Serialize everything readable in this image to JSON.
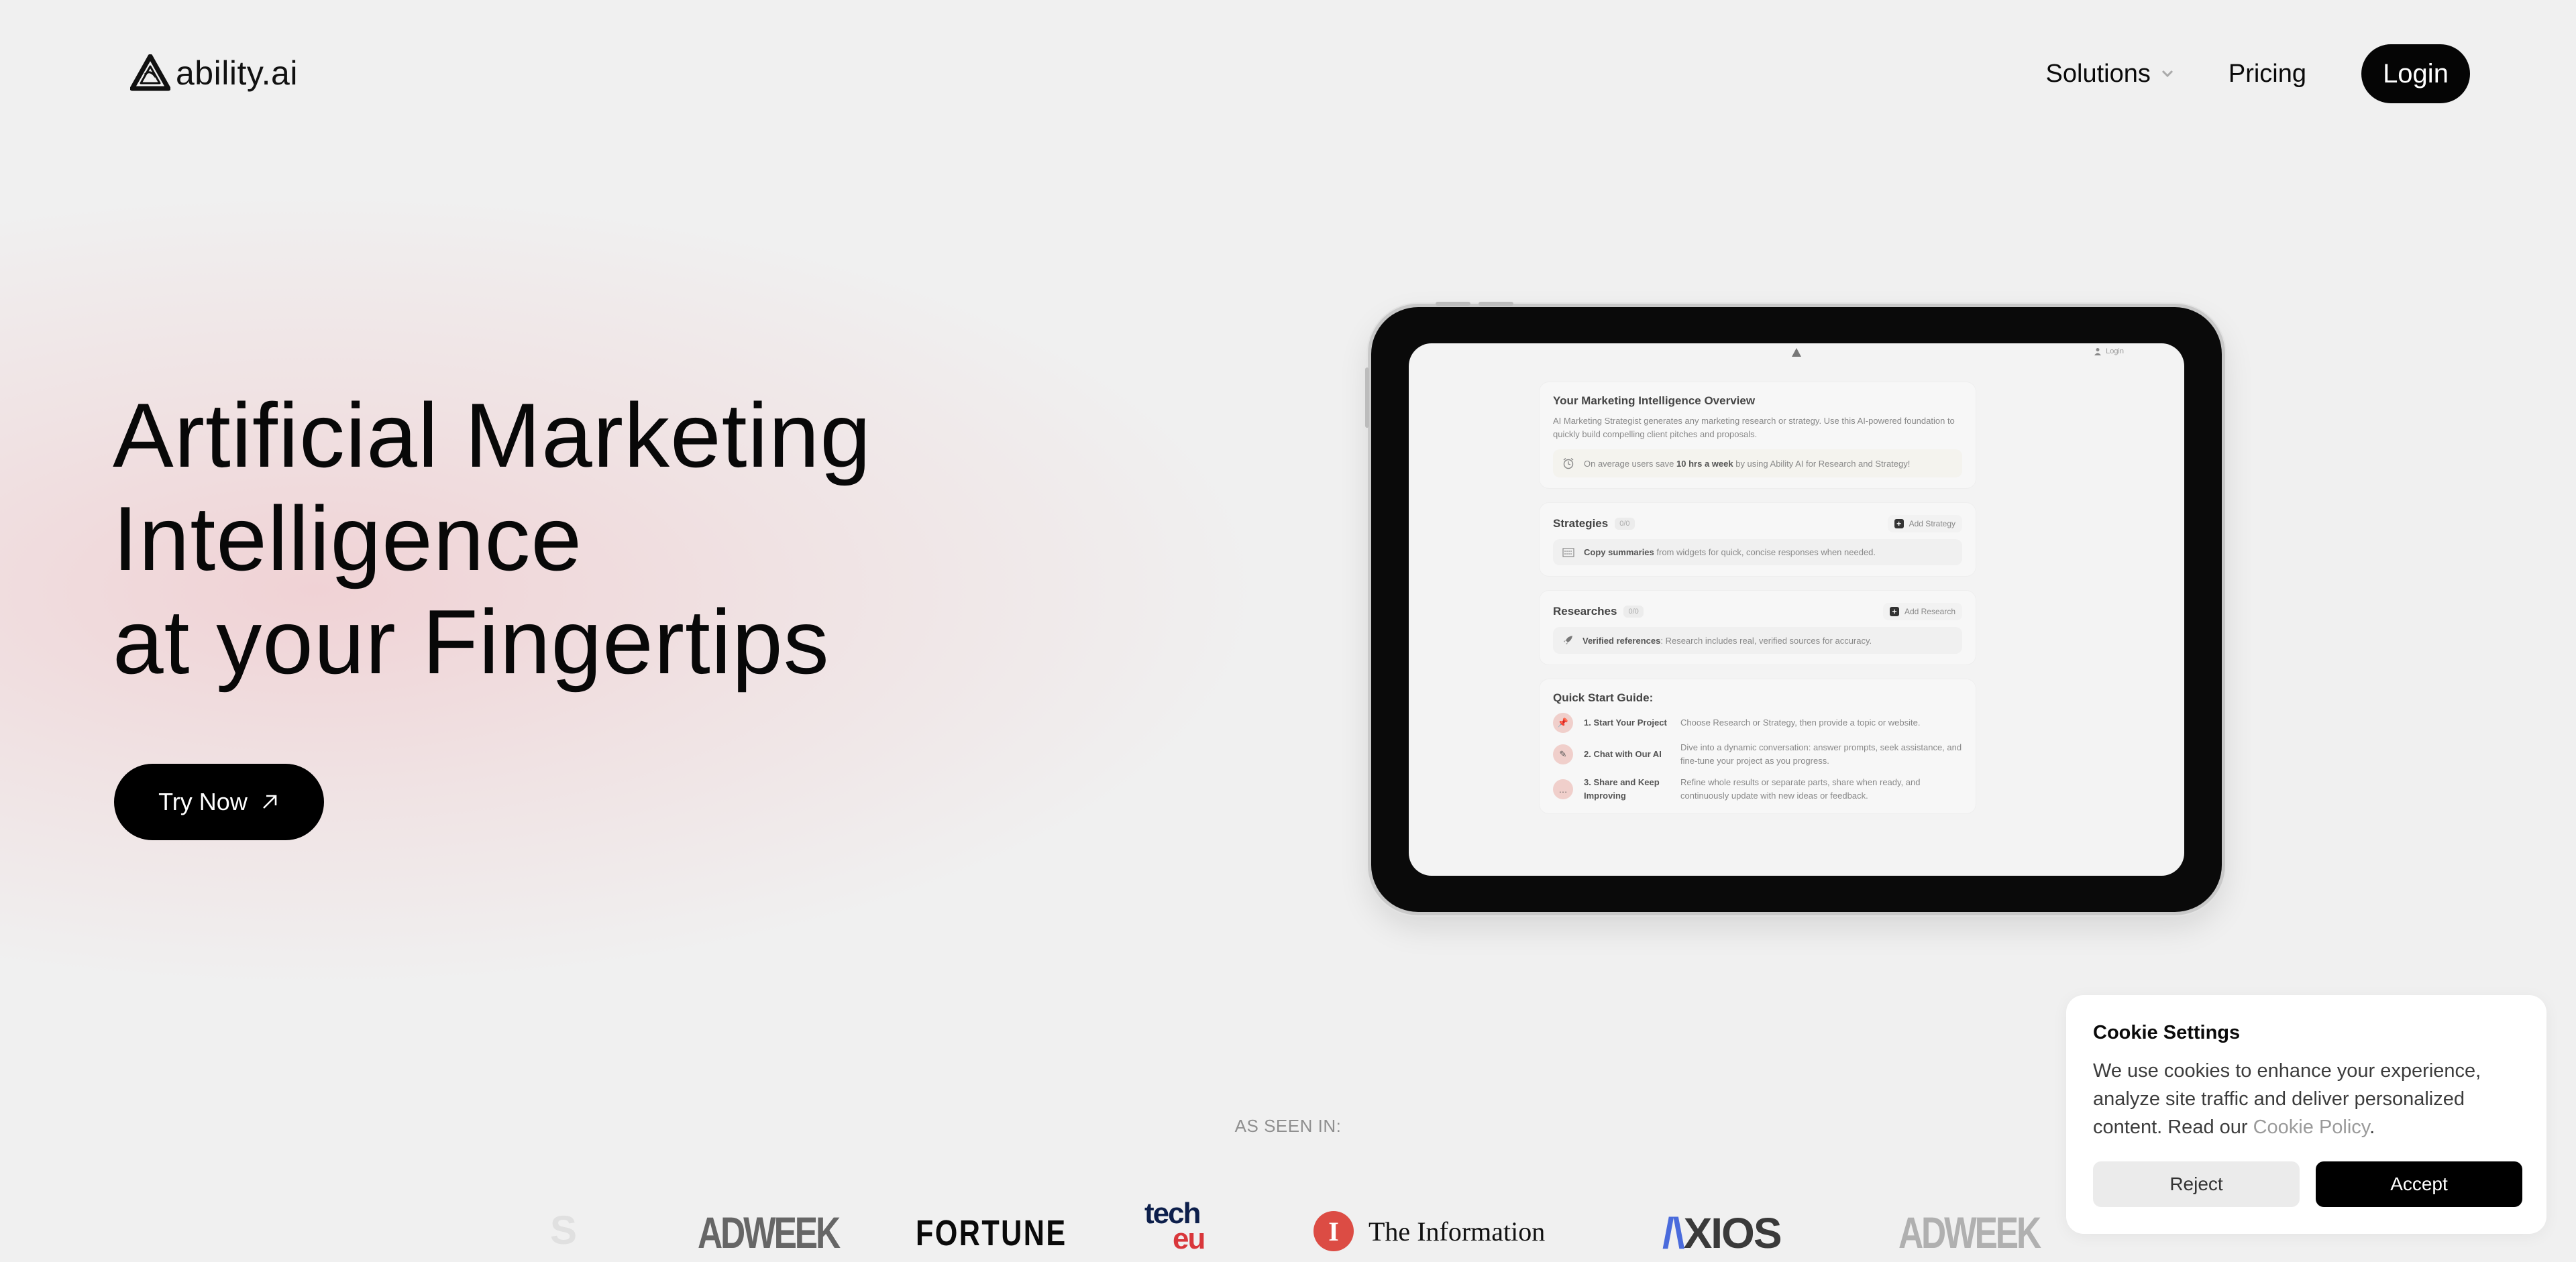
{
  "header": {
    "brand": "ability.ai",
    "nav": {
      "solutions": "Solutions",
      "pricing": "Pricing",
      "login": "Login"
    }
  },
  "hero": {
    "title_lines": [
      "Artificial Marketing",
      "Intelligence",
      "at your Fingertips"
    ],
    "cta": "Try Now"
  },
  "tablet": {
    "login": "Login",
    "overview": {
      "title": "Your Marketing Intelligence Overview",
      "description": "AI Marketing Strategist generates any marketing research or strategy. Use this AI-powered foundation to quickly build compelling client pitches and proposals.",
      "tip_prefix": "On average users save",
      "tip_bold": "10 hrs a week",
      "tip_suffix": "by using Ability AI for Research and Strategy!"
    },
    "strategies": {
      "title": "Strategies",
      "count": "0/0",
      "add": "Add Strategy",
      "tip_bold": "Copy summaries",
      "tip_text": "from widgets for quick, concise responses when needed."
    },
    "researches": {
      "title": "Researches",
      "count": "0/0",
      "add": "Add Research",
      "tip_bold": "Verified references",
      "tip_text": ": Research includes real, verified sources for accuracy."
    },
    "guide": {
      "title": "Quick Start Guide:",
      "steps": [
        {
          "label": "1. Start Your Project",
          "desc": "Choose Research or Strategy, then provide a topic or website.",
          "icon": "pin-icon"
        },
        {
          "label": "2. Chat with Our AI",
          "desc": "Dive into a dynamic conversation: answer prompts, seek assistance, and fine-tune your project as you progress.",
          "icon": "pencil-icon"
        },
        {
          "label": "3. Share and Keep Improving",
          "desc": "Refine whole results or separate parts, share when ready, and continuously update with new ideas or feedback.",
          "icon": "chat-bubble-icon"
        }
      ]
    }
  },
  "press": {
    "label": "AS SEEN IN:",
    "logos": {
      "partial": "S",
      "adweek": "ADWEEK",
      "fortune": "FORTUNE",
      "techeu_top": "tech",
      "techeu_bottom": "eu",
      "information_badge": "I",
      "information": "The Information",
      "axios_a": "/\\",
      "axios_rest": "XIOS",
      "adweek2": "ADWEEK"
    }
  },
  "cookie": {
    "title": "Cookie Settings",
    "body": "We use cookies to enhance your experience, analyze site traffic and deliver personalized content. Read our ",
    "link": "Cookie Policy",
    "period": ".",
    "reject": "Reject",
    "accept": "Accept"
  },
  "colors": {
    "background": "#f0f0f0",
    "primary_button": "#000000",
    "hero_glow": "#f0c8cc",
    "info_red": "#dc4c44",
    "axios_blue": "#4a6bdc",
    "techeu_navy": "#0d1f4b",
    "techeu_red": "#d9373b"
  }
}
